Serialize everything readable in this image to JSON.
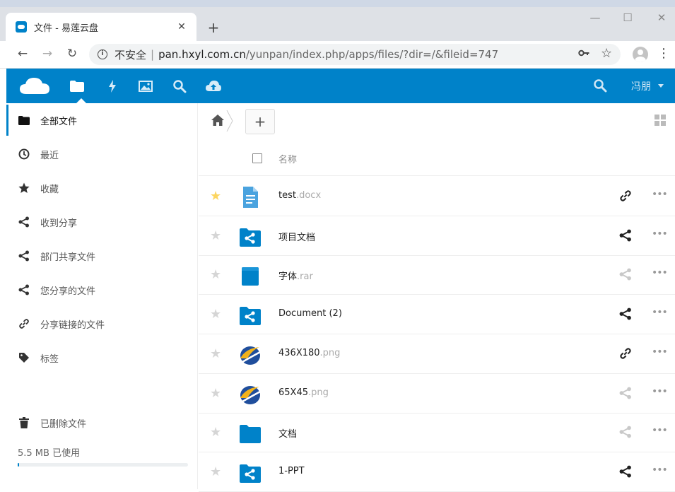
{
  "browser": {
    "tab_title": "文件 - 易莲云盘",
    "tab_close": "✕",
    "new_tab": "+",
    "security_label": "不安全",
    "separator": "|",
    "url_host": "pan.hxyl.com.cn",
    "url_path": "/yunpan/index.php/apps/files/?dir=/&fileid=747",
    "window_controls": [
      "—",
      "☐",
      "✕"
    ]
  },
  "header": {
    "username": "冯朋",
    "accent_color": "#0082c9"
  },
  "sidebar": {
    "items": [
      {
        "label": "全部文件",
        "icon": "folder-icon",
        "active": true
      },
      {
        "label": "最近",
        "icon": "clock-icon"
      },
      {
        "label": "收藏",
        "icon": "star-icon"
      },
      {
        "label": "收到分享",
        "icon": "share-icon"
      },
      {
        "label": "部门共享文件",
        "icon": "share-icon"
      },
      {
        "label": "您分享的文件",
        "icon": "share-icon"
      },
      {
        "label": "分享链接的文件",
        "icon": "link-icon"
      },
      {
        "label": "标签",
        "icon": "tag-icon"
      }
    ],
    "trash_label": "已删除文件",
    "quota_text": "5.5 MB 已使用",
    "quota_fraction": 0.01
  },
  "files": {
    "add_label": "+",
    "column_name": "名称",
    "rows": [
      {
        "base": "test",
        "ext": ".docx",
        "icon": "document-icon",
        "favorite": true,
        "share": "link"
      },
      {
        "base": "项目文档",
        "ext": "",
        "icon": "shared-folder-icon",
        "favorite": false,
        "share": "shared"
      },
      {
        "base": "字体",
        "ext": ".rar",
        "icon": "archive-icon",
        "favorite": false,
        "share": "none"
      },
      {
        "base": "Document (2)",
        "ext": "",
        "icon": "shared-folder-icon",
        "favorite": false,
        "share": "shared"
      },
      {
        "base": "436X180",
        "ext": ".png",
        "icon": "image-logo-icon",
        "favorite": false,
        "share": "link"
      },
      {
        "base": "65X45",
        "ext": ".png",
        "icon": "image-logo-icon",
        "favorite": false,
        "share": "none"
      },
      {
        "base": "文档",
        "ext": "",
        "icon": "folder-icon",
        "favorite": false,
        "share": "none"
      },
      {
        "base": "1-PPT",
        "ext": "",
        "icon": "shared-folder-icon",
        "favorite": false,
        "share": "shared"
      }
    ]
  }
}
